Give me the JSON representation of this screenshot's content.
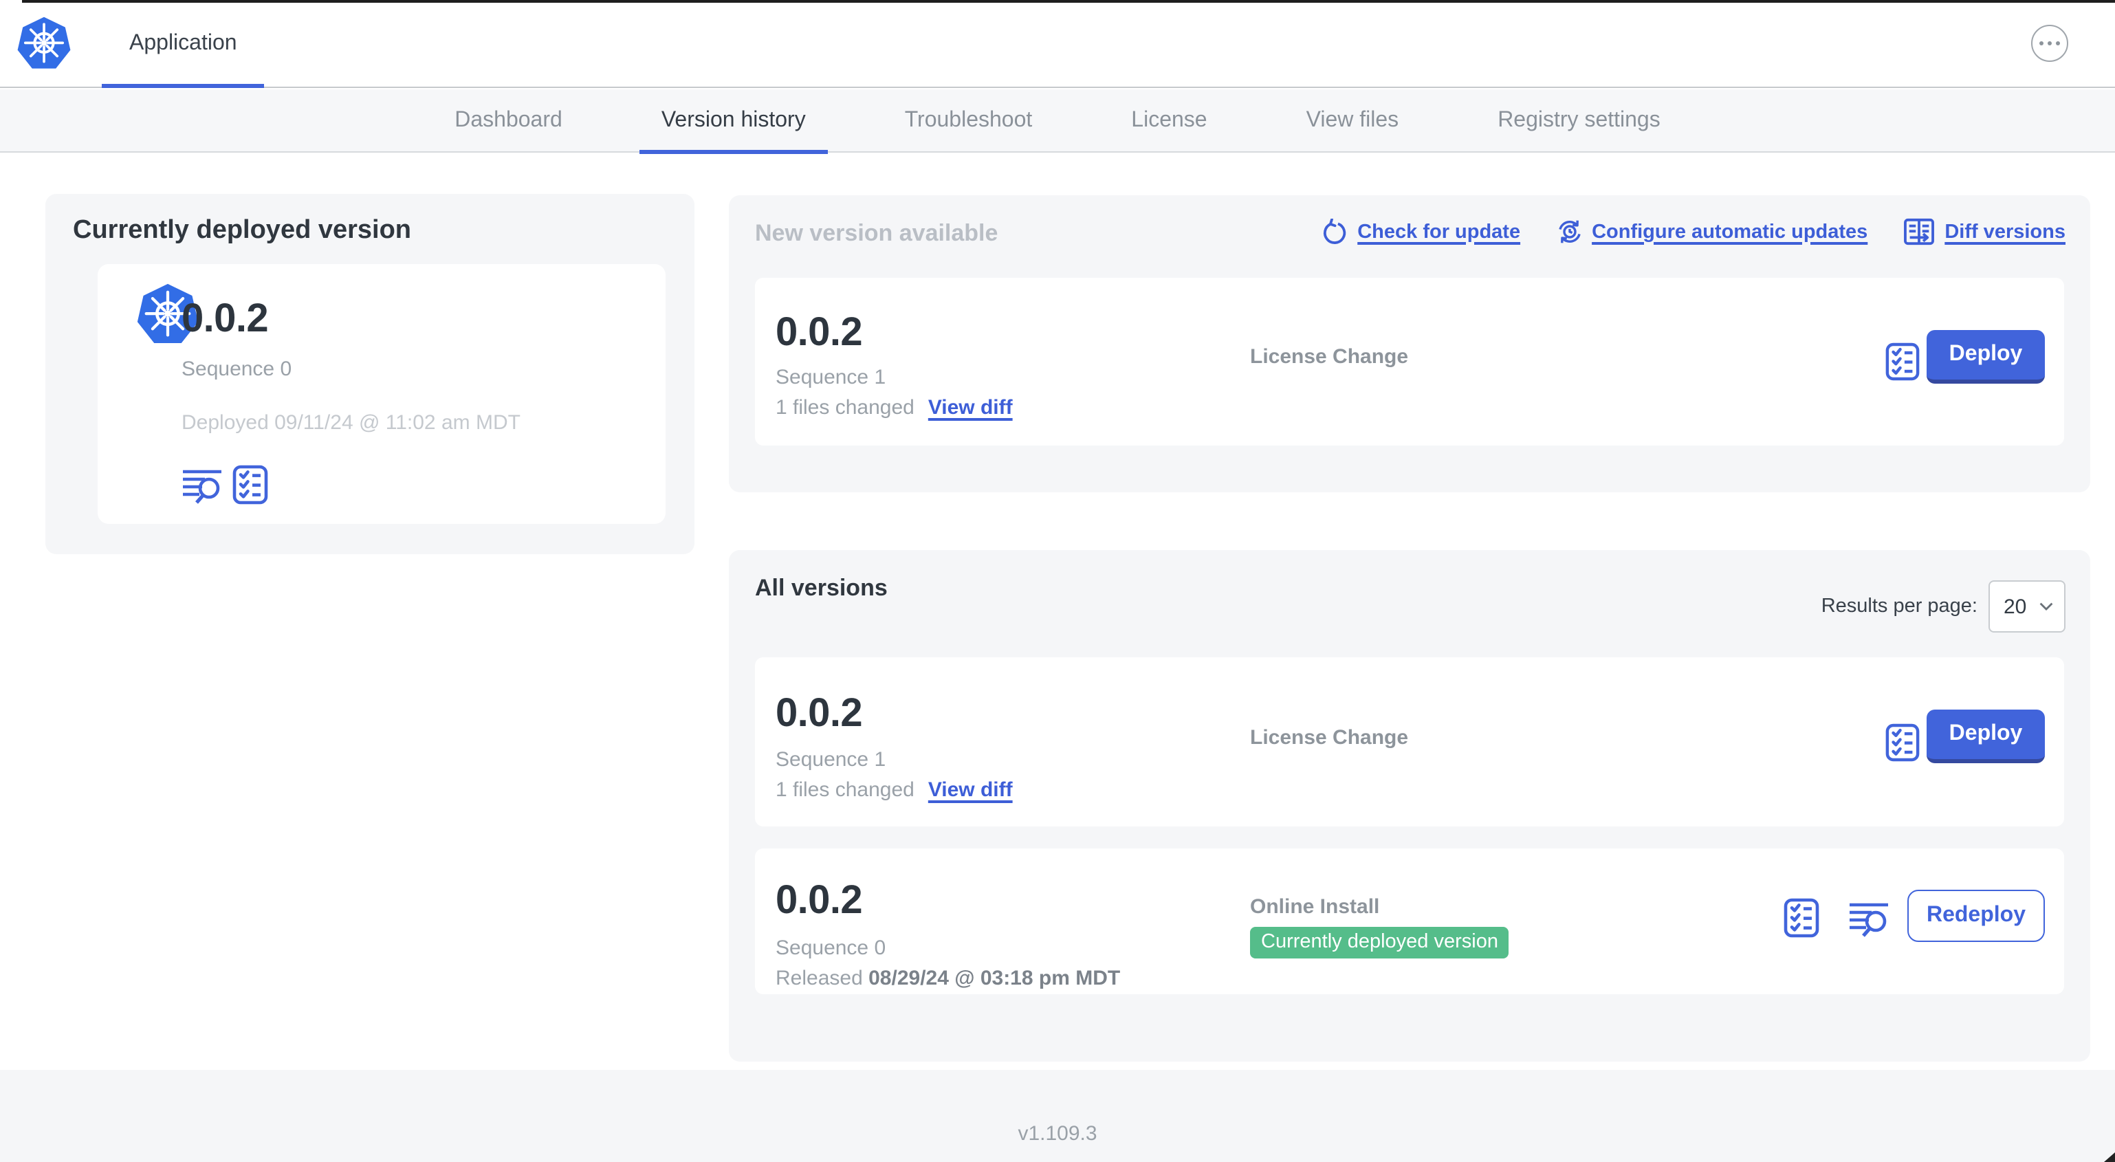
{
  "colors": {
    "accent_blue": "#4164db",
    "link_blue": "#3d5ed7",
    "badge_green": "#55bd8a",
    "k8s_blue": "#326de6"
  },
  "topbar": {
    "app_tab_label": "Application"
  },
  "nav": {
    "tabs": [
      {
        "label": "Dashboard",
        "active": false
      },
      {
        "label": "Version history",
        "active": true
      },
      {
        "label": "Troubleshoot",
        "active": false
      },
      {
        "label": "License",
        "active": false
      },
      {
        "label": "View files",
        "active": false
      },
      {
        "label": "Registry settings",
        "active": false
      }
    ]
  },
  "current_version": {
    "title": "Currently deployed version",
    "version": "0.0.2",
    "sequence": "Sequence 0",
    "deployed": "Deployed 09/11/24 @ 11:02 am MDT"
  },
  "new_version": {
    "title": "New version available",
    "links": {
      "check": "Check for update",
      "configure": "Configure automatic updates",
      "diff": "Diff versions"
    },
    "card": {
      "version": "0.0.2",
      "sequence": "Sequence 1",
      "files_changed": "1 files changed",
      "view_diff": "View diff",
      "source": "License Change",
      "deploy_label": "Deploy"
    }
  },
  "all_versions": {
    "title": "All versions",
    "per_page_label": "Results per page:",
    "per_page_value": "20",
    "rows": [
      {
        "version": "0.0.2",
        "sequence": "Sequence 1",
        "files_changed": "1 files changed",
        "view_diff": "View diff",
        "source": "License Change",
        "action_label": "Deploy"
      },
      {
        "version": "0.0.2",
        "sequence": "Sequence 0",
        "released_prefix": "Released",
        "released_date": "08/29/24 @ 03:18 pm MDT",
        "source": "Online Install",
        "badge": "Currently deployed version",
        "action_label": "Redeploy"
      }
    ]
  },
  "footer": {
    "version": "v1.109.3"
  }
}
